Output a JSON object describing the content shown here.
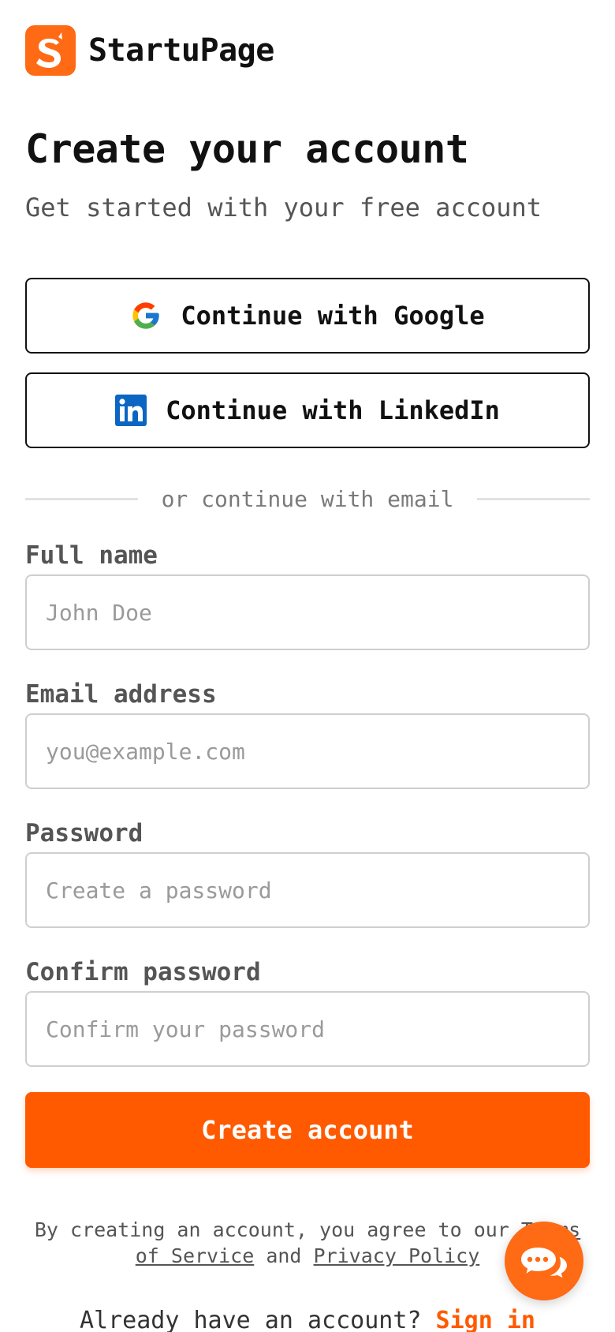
{
  "brand": {
    "name": "StartuPage",
    "logo_letter": "S",
    "accent_color": "#ff6a14"
  },
  "header": {
    "title": "Create your account",
    "subtitle": "Get started with your free account"
  },
  "social": {
    "google_label": "Continue with Google",
    "linkedin_label": "Continue with LinkedIn"
  },
  "divider": {
    "text": "or continue with email"
  },
  "form": {
    "full_name": {
      "label": "Full name",
      "placeholder": "John Doe",
      "value": ""
    },
    "email": {
      "label": "Email address",
      "placeholder": "you@example.com",
      "value": ""
    },
    "password": {
      "label": "Password",
      "placeholder": "Create a password",
      "value": ""
    },
    "confirm_password": {
      "label": "Confirm password",
      "placeholder": "Confirm your password",
      "value": ""
    },
    "submit_label": "Create account",
    "submit_color": "#ff5a00"
  },
  "legal": {
    "prefix": "By creating an account, you agree to our ",
    "terms_label": "Terms of Service",
    "conjunction": " and ",
    "privacy_label": "Privacy Policy"
  },
  "signin": {
    "prompt": "Already have an account? ",
    "link_label": "Sign in"
  },
  "chat": {
    "icon": "chat-bubble-icon"
  }
}
